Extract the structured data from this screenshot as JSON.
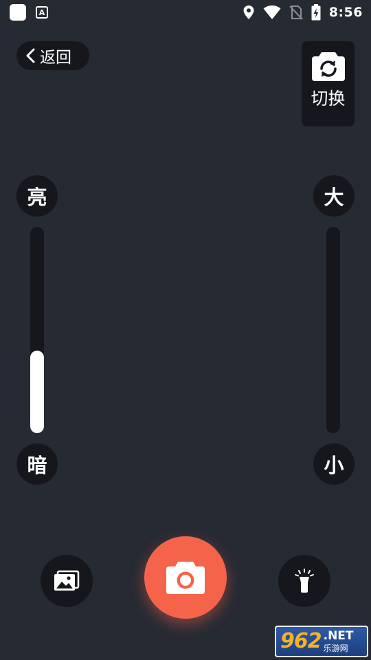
{
  "status_bar": {
    "time": "8:56",
    "notification_icons": [
      "app-white-square-icon",
      "a-app-icon"
    ],
    "a_icon_text": "A",
    "system_icons": [
      "location-icon",
      "wifi-icon",
      "no-sim-icon",
      "battery-charging-icon"
    ]
  },
  "top_bar": {
    "back_label": "返回",
    "switch_label": "切换"
  },
  "brightness": {
    "top_label": "亮",
    "bottom_label": "暗",
    "level": 0.4
  },
  "zoom": {
    "top_label": "大",
    "bottom_label": "小",
    "level": 0.0
  },
  "bottom_bar": {
    "gallery_icon": "gallery-icon",
    "shutter_icon": "camera-icon",
    "flashlight_icon": "flashlight-icon"
  },
  "watermark": {
    "number": "962",
    "domain": ".NET",
    "caption": "乐游网"
  },
  "colors": {
    "background": "#262a33",
    "control_bg": "#15171c",
    "shutter": "#f5644a",
    "slider_fill": "#ffffff"
  }
}
